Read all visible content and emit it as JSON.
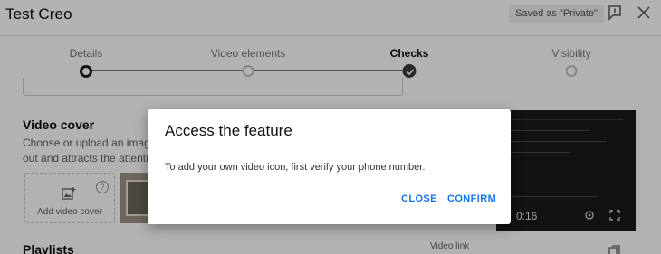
{
  "header": {
    "title": "Test Creo",
    "saved_badge": "Saved as \"Private\""
  },
  "steps": [
    {
      "label": "Details",
      "state": "current"
    },
    {
      "label": "Video elements",
      "state": "todo"
    },
    {
      "label": "Checks",
      "state": "active"
    },
    {
      "label": "Visibility",
      "state": "todo"
    }
  ],
  "content": {
    "video_cover_title": "Video cover",
    "video_cover_desc_line1": "Choose or upload an image that",
    "video_cover_desc_line2": "out and attracts the attention o",
    "add_cover_label": "Add video cover",
    "help_glyph": "?",
    "playlists_title": "Playlists",
    "video_time": "0:16",
    "video_link_label": "Video link"
  },
  "dialog": {
    "title": "Access the feature",
    "message": "To add your own video icon, first verify your phone number.",
    "close_label": "CLOSE",
    "confirm_label": "CONFIRM"
  },
  "colors": {
    "accent": "#1a73e8",
    "overlay": "rgba(0,0,0,0.3)"
  }
}
